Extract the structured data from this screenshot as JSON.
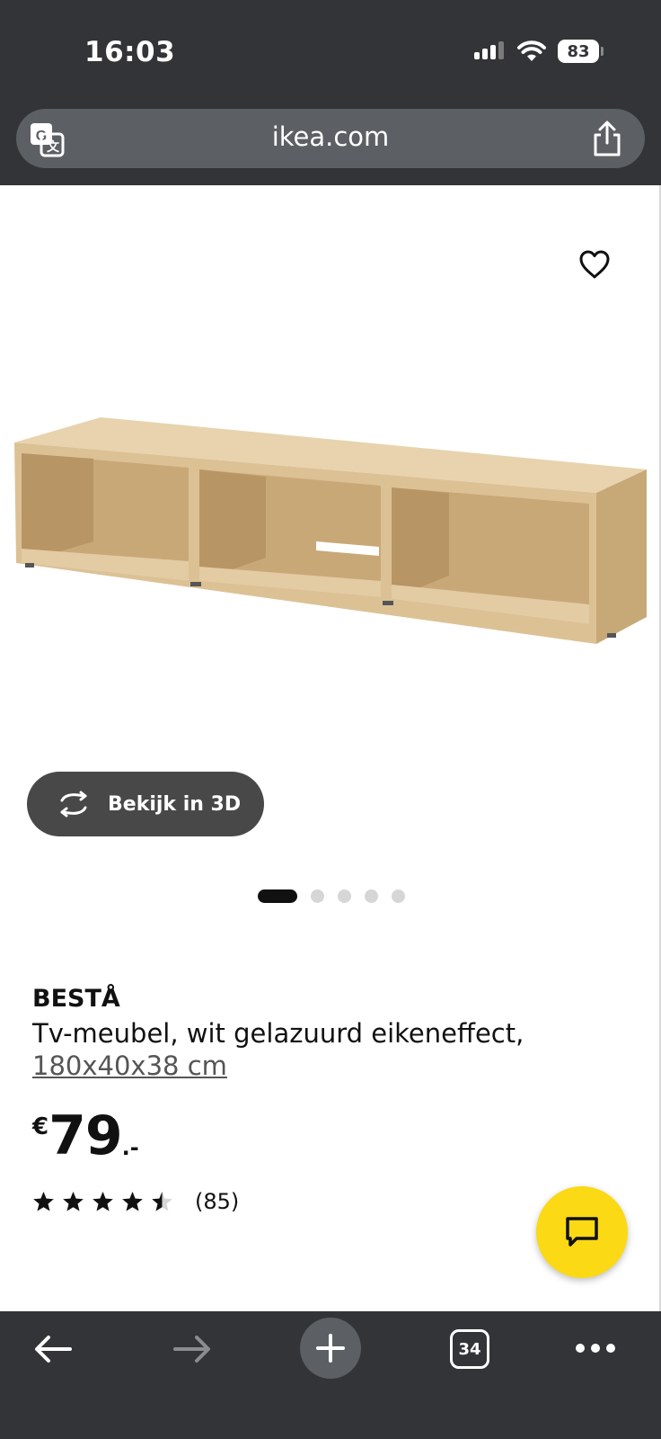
{
  "status_bar": {
    "time": "16:03",
    "battery": "83",
    "icons": [
      "signal-icon",
      "wifi-icon",
      "battery-icon"
    ]
  },
  "browser": {
    "url": "ikea.com",
    "icons": [
      "translate-icon",
      "share-icon"
    ]
  },
  "product": {
    "name": "BESTÅ",
    "description": "Tv-meubel, wit gelazuurd eikeneffect,",
    "size": "180x40x38 cm",
    "price_currency": "€",
    "price_value": "79",
    "price_decimals": ".-",
    "rating": 4.5,
    "rating_max": 5,
    "review_count": "(85)",
    "view_3d_label": "Bekijk in 3D",
    "gallery_image_count": 5,
    "gallery_active_index": 1
  },
  "toolbar": {
    "tab_count": "34",
    "icons": [
      "back-arrow-icon",
      "forward-arrow-icon",
      "plus-icon",
      "tabs-icon",
      "more-icon"
    ]
  },
  "colors": {
    "chrome_bg": "#323437",
    "url_bar_bg": "#5c5f63",
    "chat_button": "#fbd914",
    "button_3d_bg": "#484848"
  }
}
